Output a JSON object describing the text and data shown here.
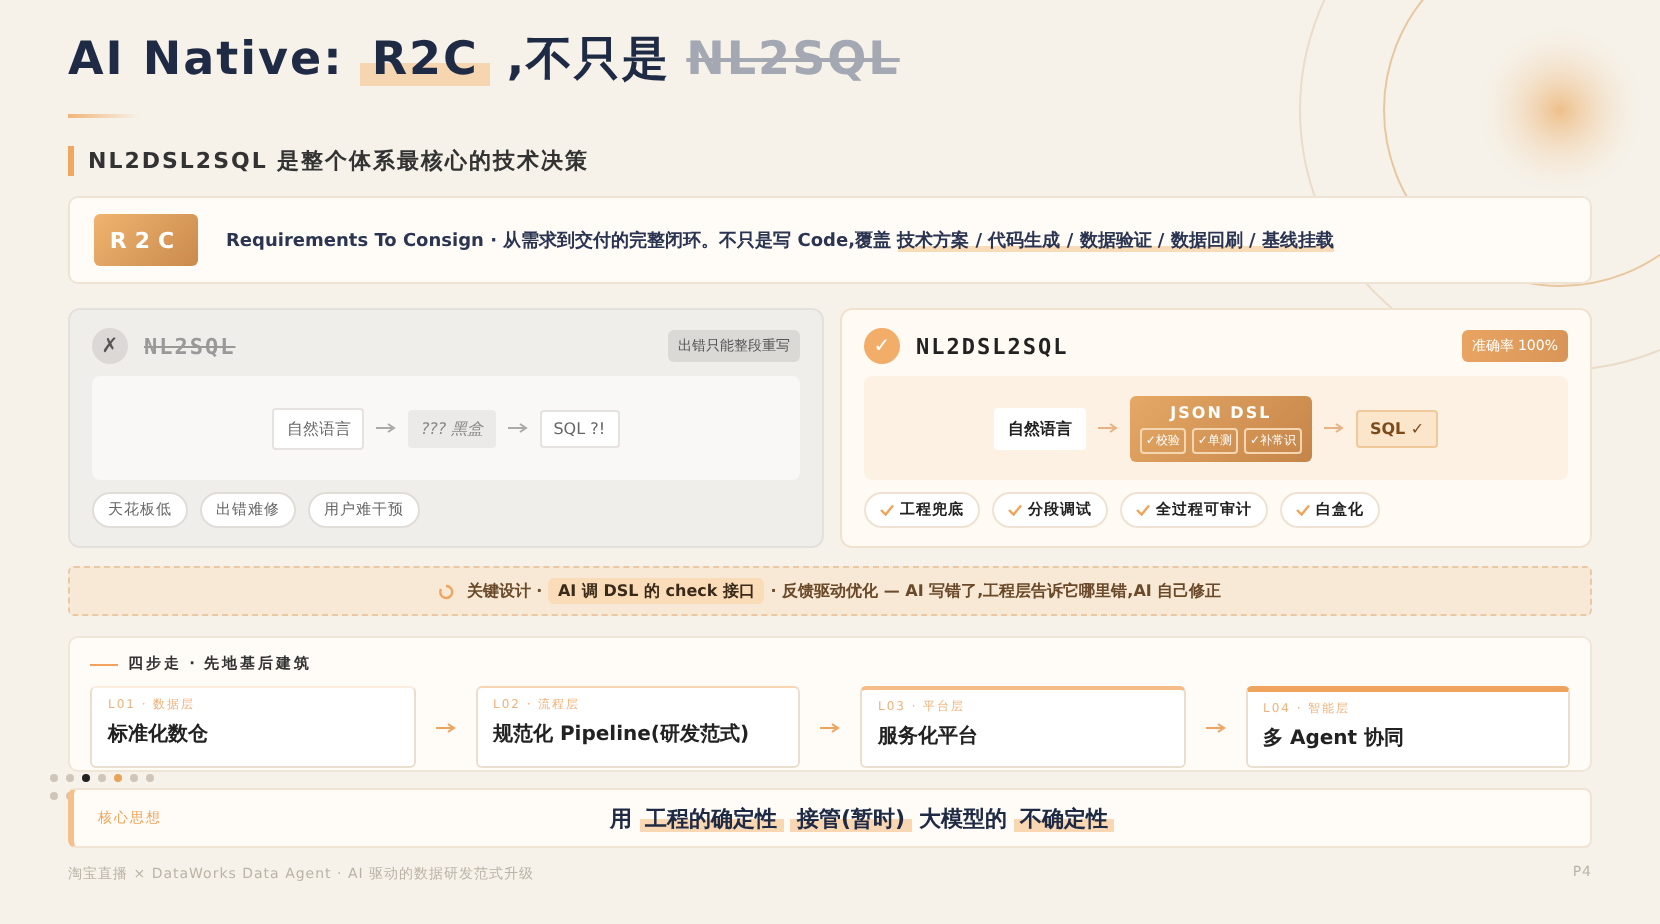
{
  "title": {
    "parts": [
      {
        "kind": "plain",
        "text": "AI Native:"
      },
      {
        "kind": "highlight",
        "text": "R2C"
      },
      {
        "kind": "plain",
        "text": ",不只是"
      },
      {
        "kind": "strike",
        "text": "NL2SQL"
      }
    ]
  },
  "subtitle": "NL2DSL2SQL 是整个体系最核心的技术决策",
  "r2c": {
    "badge": "R2C",
    "text": "Requirements To Consign · 从需求到交付的完整闭环。不只是写 Code,覆盖 **技术方案 / 代码生成 / 数据验证 / 数据回刷 / 基线挂载**"
  },
  "comparisons": [
    {
      "kind": "bad",
      "icon": "✗",
      "title": "NL2SQL",
      "badge": "出错只能整段重写",
      "flow": [
        {
          "kind": "plain",
          "label": "自然语言"
        },
        {
          "kind": "muted",
          "label": "??? 黑盒"
        },
        {
          "kind": "plain",
          "label": "SQL ?!"
        }
      ],
      "chips": [
        "天花板低",
        "出错难修",
        "用户难干预"
      ]
    },
    {
      "kind": "good",
      "icon": "✓",
      "title": "NL2DSL2SQL",
      "badge": "准确率 100%",
      "flow": [
        {
          "kind": "plain",
          "label": "自然语言"
        },
        {
          "kind": "dsl",
          "label": "JSON DSL",
          "checks": [
            "✓校验",
            "✓单测",
            "✓补常识"
          ]
        },
        {
          "kind": "result",
          "label": "SQL ✓"
        }
      ],
      "chips": [
        "工程兜底",
        "分段调试",
        "全过程可审计",
        "白盒化"
      ]
    }
  ],
  "banner": "关键设计 · **AI 调 DSL 的 check 接口** · 反馈驱动优化 — AI 写错了,工程层告诉它哪里错,AI 自己修正",
  "steps": {
    "title": "四步走 · 先地基后建筑",
    "items": [
      {
        "tag": "L01 · 数据层",
        "label": "标准化数仓"
      },
      {
        "tag": "L02 · 流程层",
        "label": "规范化 Pipeline(研发范式)"
      },
      {
        "tag": "L03 · 平台层",
        "label": "服务化平台"
      },
      {
        "tag": "L04 · 智能层",
        "label": "多 Agent 协同"
      }
    ]
  },
  "core": {
    "label": "核心思想",
    "text": "用 **工程的确定性** **接管(暂时)** 大模型的 **不确定性**"
  },
  "footer": {
    "text": "淘宝直播 × DataWorks Data Agent · AI 驱动的数据研发范式升级",
    "page": "P4"
  }
}
